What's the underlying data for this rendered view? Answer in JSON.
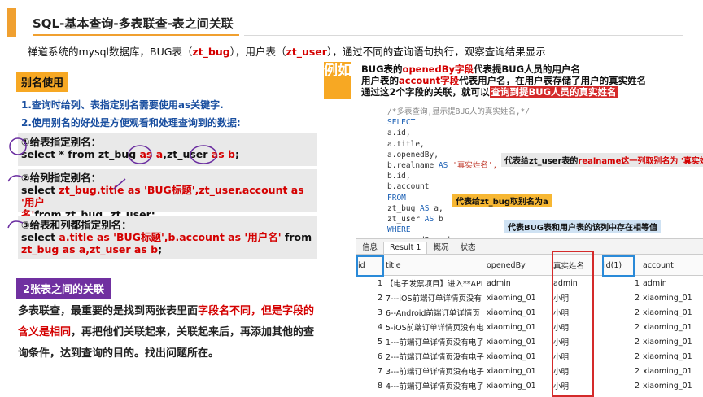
{
  "header": {
    "title": "SQL-基本查询-多表联查-表之间关联",
    "subtitle_parts": [
      "禅道系统的mysql数据库，BUG表（",
      "zt_bug",
      "），用户表（",
      "zt_user",
      "），通过不同的查询语句执行，观察查询结果显示"
    ]
  },
  "left": {
    "alias_label": "别名使用",
    "point1": "1.查询时给列、表指定别名需要使用as关键字.",
    "point2": "2.使用别名的好处是方便观看和处理查询到的数据:",
    "ex1_title": "①给表指定别名：",
    "ex1_sql_a": "select * from zt_bug ",
    "ex1_sql_b": "as a",
    "ex1_sql_c": ",zt_user ",
    "ex1_sql_d": "as b",
    "ex1_sql_e": ";",
    "ex2_title": "②给列指定别名：",
    "ex2_sql_a": "select ",
    "ex2_sql_b": "zt_bug.title as 'BUG标题',zt_user.account as '用户",
    "ex2_sql_c": "名'",
    "ex2_sql_d": "from zt_bug ,zt_user;",
    "ex3_title": "③给表和列都指定别名：",
    "ex3_sql_a": "select ",
    "ex3_sql_b": "a.title as 'BUG标题',b.account as '用户名'",
    "ex3_sql_c": " from",
    "ex3_sql_d": "zt_bug as a,zt_user as b",
    "ex3_sql_e": ";",
    "relation_label": "2张表之间的关联",
    "para_a": "多表联查，最重要的是找到两张表里面",
    "para_b": "字段名不同，但是",
    "para_c": "字段的含义是相同",
    "para_d": "，再把他们关联起来，关联起来后，再",
    "para_e": "添加其他的查询条件，达到查询的目的。找出问题所在。"
  },
  "right": {
    "example_label": "例如",
    "info1_a": "BUG表的",
    "info1_b": "openedBy字段",
    "info1_c": "代表提BUG人员的用户名",
    "info2_a": "用户表的",
    "info2_b": "account字段",
    "info2_c": "代表用户名，在用户表存储了用户的真实姓名",
    "info3_a": "通过这2个字段的关联，就可以",
    "info3_b": "查询到提BUG人员的真实姓名",
    "sql": {
      "l1": "/*多表查询,显示提BUG人的真实姓名,*/",
      "l2": "SELECT",
      "l3": "a.id,",
      "l4": "a.title,",
      "l5": "a.openedBy,",
      "l6a": "b.realname ",
      "l6b": "AS",
      "l6c": " '真实姓名',",
      "l7": "b.id,",
      "l8": "b.account",
      "l9": "FROM",
      "l10a": "  zt_bug ",
      "l10b": "AS",
      "l10c": " a,",
      "l11a": "  zt_user ",
      "l11b": "AS",
      "l11c": " b",
      "l12": "WHERE",
      "l13": "  a.openedBy = b.account;"
    },
    "note1_a": "代表给zt_user表的",
    "note1_b": "realname这一列取别名为 '真实姓",
    "note2": "代表给zt_bug取别名为a",
    "note3": "代表BUG表和用户表的该列中存在相等值",
    "tabs": [
      "信息",
      "Result 1",
      "概况",
      "状态"
    ],
    "columns": [
      "id",
      "title",
      "openedBy",
      "真实姓名",
      "id(1)",
      "account"
    ],
    "rows": [
      [
        "1",
        "【电子发票项目】进入**API",
        "admin",
        "admin",
        "1",
        "admin"
      ],
      [
        "2",
        "7---iOS前端订单详情页没有",
        "xiaoming_01",
        "小明",
        "2",
        "xiaoming_01"
      ],
      [
        "3",
        "6--Android前端订单详情页",
        "xiaoming_01",
        "小明",
        "2",
        "xiaoming_01"
      ],
      [
        "4",
        "5-iOS前端订单详情页没有电",
        "xiaoming_01",
        "小明",
        "2",
        "xiaoming_01"
      ],
      [
        "5",
        "1---前端订单详情页没有电子",
        "xiaoming_01",
        "小明",
        "2",
        "xiaoming_01"
      ],
      [
        "6",
        "2---前端订单详情页没有电子",
        "xiaoming_01",
        "小明",
        "2",
        "xiaoming_01"
      ],
      [
        "7",
        "3---前端订单详情页没有电子",
        "xiaoming_01",
        "小明",
        "2",
        "xiaoming_01"
      ],
      [
        "8",
        "4---前端订单详情页没有电子",
        "xiaoming_01",
        "小明",
        "2",
        "xiaoming_01"
      ]
    ]
  },
  "colors": {
    "accent": "#f7a823",
    "red": "#d40000",
    "purple": "#7030a0",
    "blue": "#1a4fa0"
  }
}
